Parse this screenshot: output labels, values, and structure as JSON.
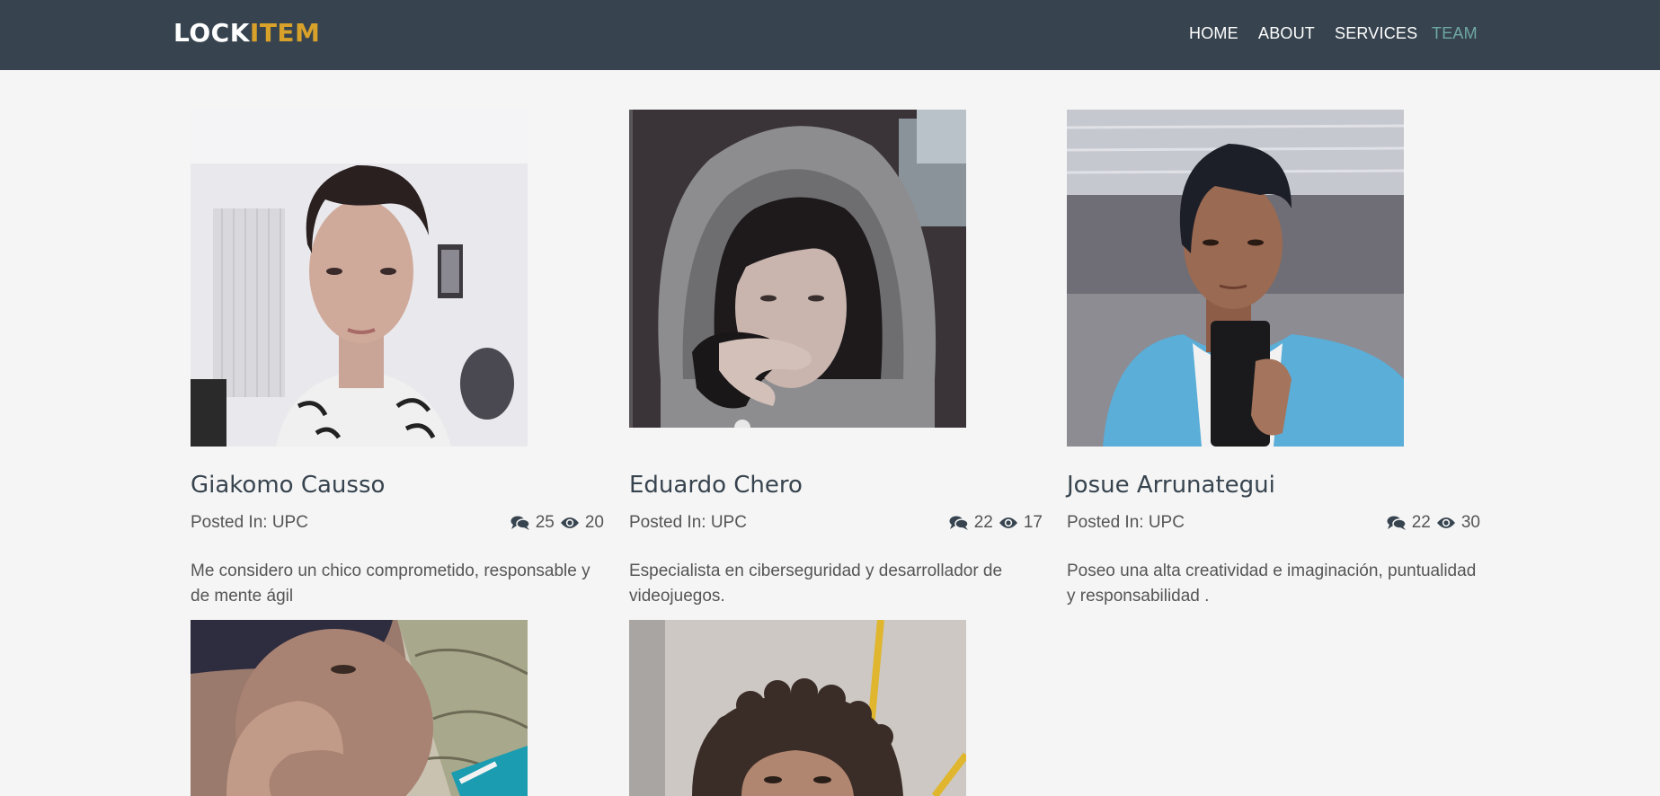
{
  "brand": {
    "part1": "LOCK",
    "part2": "ITEM",
    "accent_color": "#d8a12a"
  },
  "nav": {
    "home": "HOME",
    "about": "ABOUT",
    "services": "SERVICES",
    "team": "TEAM",
    "active": "TEAM"
  },
  "members": [
    {
      "name": "Giakomo Causso",
      "posted": "Posted In: UPC",
      "comments": "25",
      "views": "20",
      "description": "Me considero un chico comprometido, responsable y de mente ágil"
    },
    {
      "name": "Eduardo Chero",
      "posted": "Posted In: UPC",
      "comments": "22",
      "views": "17",
      "description": "Especialista en ciberseguridad y desarrollador de videojuegos."
    },
    {
      "name": "Josue Arrunategui",
      "posted": "Posted In: UPC",
      "comments": "22",
      "views": "30",
      "description": "Poseo una alta creatividad e imaginación, puntualidad y responsabilidad ."
    }
  ],
  "icons": {
    "comments": "comments-icon",
    "views": "eye-icon"
  },
  "colors": {
    "navbar": "#37444f",
    "nav_active": "#6fa7a6",
    "background": "#f5f5f5"
  }
}
